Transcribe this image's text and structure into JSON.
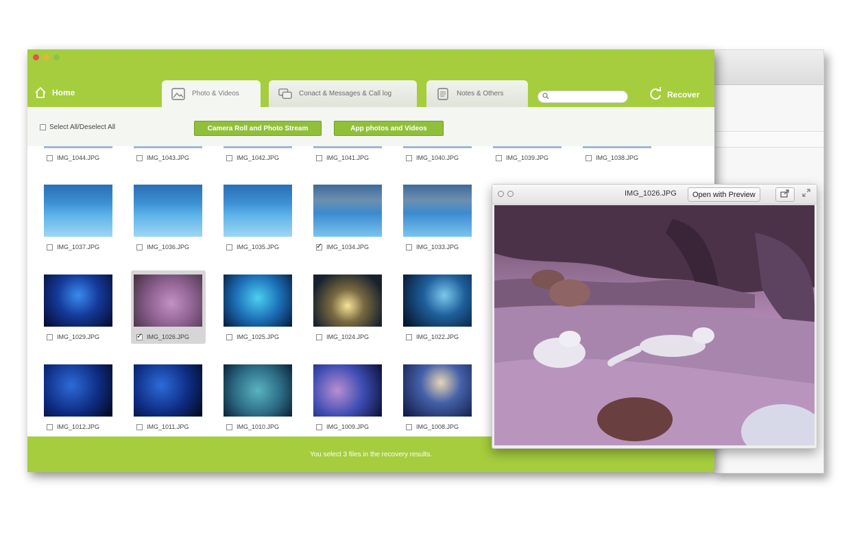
{
  "window": {
    "controls": [
      "close",
      "minimize",
      "zoom"
    ]
  },
  "header": {
    "home_label": "Home",
    "tabs": [
      {
        "label": "Photo & Videos",
        "icon": "image-icon",
        "active": true
      },
      {
        "label": "Conact & Messages & Call log",
        "icon": "chat-icon",
        "active": false
      },
      {
        "label": "Notes & Others",
        "icon": "note-icon",
        "active": false
      }
    ],
    "search": {
      "value": "",
      "placeholder": ""
    },
    "recover_label": "Recover"
  },
  "toolbar": {
    "select_all_label": "Select All/Deselect All",
    "categories": [
      "Camera Roll and Photo Stream",
      "App photos and Videos"
    ]
  },
  "files": {
    "top_row": [
      "IMG_1044.JPG",
      "IMG_1043.JPG",
      "IMG_1042.JPG",
      "IMG_1041.JPG",
      "IMG_1040.JPG",
      "IMG_1039.JPG",
      "IMG_1038.JPG"
    ],
    "rows": [
      [
        {
          "name": "IMG_1037.JPG",
          "checked": false
        },
        {
          "name": "IMG_1036.JPG",
          "checked": false
        },
        {
          "name": "IMG_1035.JPG",
          "checked": false
        },
        {
          "name": "IMG_1034.JPG",
          "checked": true
        },
        {
          "name": "IMG_1033.JPG",
          "checked": false
        }
      ],
      [
        {
          "name": "IMG_1029.JPG",
          "checked": false
        },
        {
          "name": "IMG_1026.JPG",
          "checked": true,
          "selected": true
        },
        {
          "name": "IMG_1025.JPG",
          "checked": false
        },
        {
          "name": "IMG_1024.JPG",
          "checked": false
        },
        {
          "name": "IMG_1022.JPG",
          "checked": false
        }
      ],
      [
        {
          "name": "IMG_1012.JPG",
          "checked": false
        },
        {
          "name": "IMG_1011.JPG",
          "checked": false
        },
        {
          "name": "IMG_1010.JPG",
          "checked": false
        },
        {
          "name": "IMG_1009.JPG",
          "checked": false
        },
        {
          "name": "IMG_1008.JPG",
          "checked": false
        }
      ]
    ]
  },
  "status": {
    "text": "You select 3 files in the recovery results."
  },
  "preview": {
    "filename": "IMG_1026.JPG",
    "open_label": "Open with Preview",
    "share_icon": "share-icon",
    "expand_icon": "expand-icon"
  },
  "colors": {
    "accent": "#a5cd3d",
    "button": "#90c03a"
  }
}
